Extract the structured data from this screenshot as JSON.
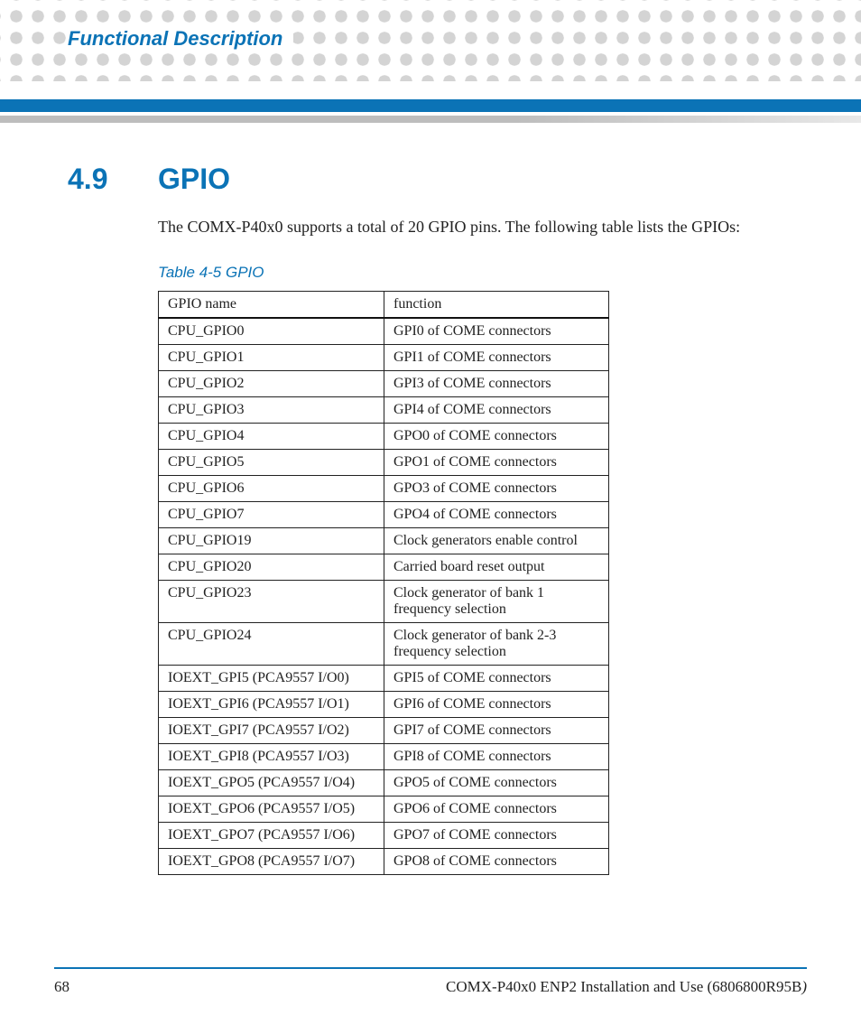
{
  "header": {
    "chapter_title": "Functional Description"
  },
  "section": {
    "number": "4.9",
    "title": "GPIO",
    "intro": "The COMX-P40x0 supports a total of 20 GPIO pins. The following table lists the GPIOs:"
  },
  "table": {
    "caption": "Table 4-5 GPIO",
    "headers": [
      "GPIO name",
      "function"
    ],
    "rows": [
      [
        "CPU_GPIO0",
        "GPI0 of COME connectors"
      ],
      [
        "CPU_GPIO1",
        "GPI1 of COME connectors"
      ],
      [
        "CPU_GPIO2",
        "GPI3 of COME connectors"
      ],
      [
        "CPU_GPIO3",
        "GPI4 of COME connectors"
      ],
      [
        "CPU_GPIO4",
        "GPO0 of COME connectors"
      ],
      [
        "CPU_GPIO5",
        "GPO1 of COME connectors"
      ],
      [
        "CPU_GPIO6",
        "GPO3 of COME connectors"
      ],
      [
        "CPU_GPIO7",
        "GPO4 of COME connectors"
      ],
      [
        "CPU_GPIO19",
        "Clock generators enable control"
      ],
      [
        "CPU_GPIO20",
        "Carried board reset output"
      ],
      [
        "CPU_GPIO23",
        "Clock generator of bank 1 frequency selection"
      ],
      [
        "CPU_GPIO24",
        "Clock generator of bank 2-3 frequency selection"
      ],
      [
        "IOEXT_GPI5 (PCA9557 I/O0)",
        "GPI5 of COME connectors"
      ],
      [
        "IOEXT_GPI6 (PCA9557 I/O1)",
        "GPI6 of COME connectors"
      ],
      [
        "IOEXT_GPI7 (PCA9557 I/O2)",
        "GPI7 of COME connectors"
      ],
      [
        "IOEXT_GPI8 (PCA9557 I/O3)",
        "GPI8 of COME connectors"
      ],
      [
        "IOEXT_GPO5 (PCA9557 I/O4)",
        "GPO5 of COME connectors"
      ],
      [
        "IOEXT_GPO6 (PCA9557 I/O5)",
        "GPO6 of COME connectors"
      ],
      [
        "IOEXT_GPO7 (PCA9557 I/O6)",
        "GPO7 of COME connectors"
      ],
      [
        "IOEXT_GPO8 (PCA9557 I/O7)",
        "GPO8 of COME connectors"
      ]
    ]
  },
  "footer": {
    "page": "68",
    "doc": "COMX-P40x0 ENP2 Installation and Use (6806800R95B",
    "doc_tail_italic": ")"
  }
}
